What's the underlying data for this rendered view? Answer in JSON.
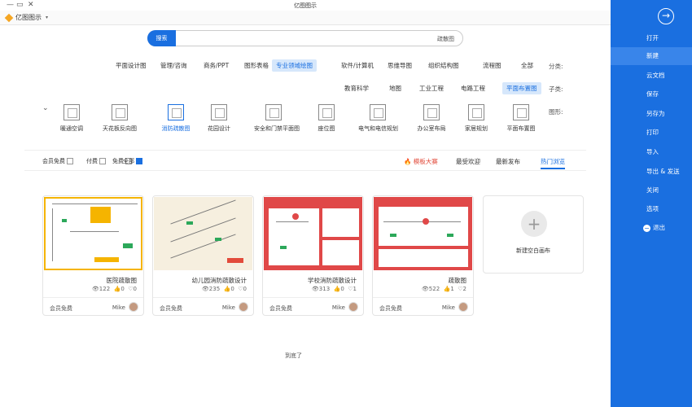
{
  "window": {
    "title": "亿图图示",
    "controls": [
      "—",
      "▭",
      "✕"
    ]
  },
  "app": {
    "name": "亿图图示",
    "dropdown": "▾"
  },
  "sidebar": {
    "back_icon": "arrow-left-circle-icon",
    "items": [
      {
        "label": "打开",
        "active": false
      },
      {
        "label": "新建",
        "active": true
      },
      {
        "label": "云文档",
        "active": false
      },
      {
        "label": "保存",
        "active": false
      },
      {
        "label": "另存为",
        "active": false
      },
      {
        "label": "打印",
        "active": false
      },
      {
        "label": "导入",
        "active": false
      },
      {
        "label": "导出 & 发送",
        "active": false
      },
      {
        "label": "关闭",
        "active": false
      },
      {
        "label": "选项",
        "active": false
      },
      {
        "label": "退出",
        "active": false
      }
    ]
  },
  "search": {
    "button": "搜索",
    "value": "疏散图"
  },
  "categories": {
    "label": "分类:",
    "items": [
      "全部",
      "流程图",
      "组织结构图",
      "思维导图",
      "软件/计算机",
      "专业领域绘图",
      "图形表格",
      "商务/PPT",
      "管理/咨询",
      "平面设计图"
    ],
    "active_index": 5
  },
  "subcategories": {
    "label": "子类:",
    "items": [
      "平面布置图",
      "电路工程",
      "工业工程",
      "地图",
      "教育科学"
    ],
    "active_index": 0
  },
  "templates": {
    "label": "图形:",
    "items": [
      "平面布置图",
      "家居规划",
      "办公室布局",
      "电气和电信规划",
      "座位图",
      "安全和门禁平面图",
      "花园设计",
      "消防疏散图",
      "天花板反向图",
      "暖通空调"
    ],
    "active_index": 7
  },
  "filters": {
    "items": [
      {
        "label": "全部",
        "checked": true
      },
      {
        "label": "免费",
        "checked": false
      },
      {
        "label": "付费",
        "checked": false
      },
      {
        "label": "会员免费",
        "checked": false
      }
    ],
    "sorts": [
      {
        "label": "热门浏览",
        "active": true
      },
      {
        "label": "最新发布",
        "active": false
      },
      {
        "label": "最受欢迎",
        "active": false
      },
      {
        "label": "模板大赛",
        "active": false,
        "hot": true
      }
    ]
  },
  "new_card": {
    "label": "新建空白画布"
  },
  "cards": [
    {
      "name": "疏散图",
      "views": "522",
      "likes": "1",
      "comments": "2",
      "price": "会员免费",
      "author": "Mike",
      "theme": "red"
    },
    {
      "name": "学校消防疏散设计",
      "views": "313",
      "likes": "0",
      "comments": "1",
      "price": "会员免费",
      "author": "Mike",
      "theme": "red"
    },
    {
      "name": "幼儿园消防疏散设计",
      "views": "235",
      "likes": "0",
      "comments": "0",
      "price": "会员免费",
      "author": "Mike",
      "theme": "beige"
    },
    {
      "name": "医院疏散图",
      "views": "122",
      "likes": "0",
      "comments": "0",
      "price": "会员免费",
      "author": "Mike",
      "theme": "yellow"
    }
  ],
  "footer": {
    "loaded": "到底了"
  },
  "colors": {
    "accent": "#1a6fe0",
    "sidebar_bg": "#1a6fe0",
    "active_chip": "#d6e7fb",
    "hot": "#e24b3b"
  }
}
